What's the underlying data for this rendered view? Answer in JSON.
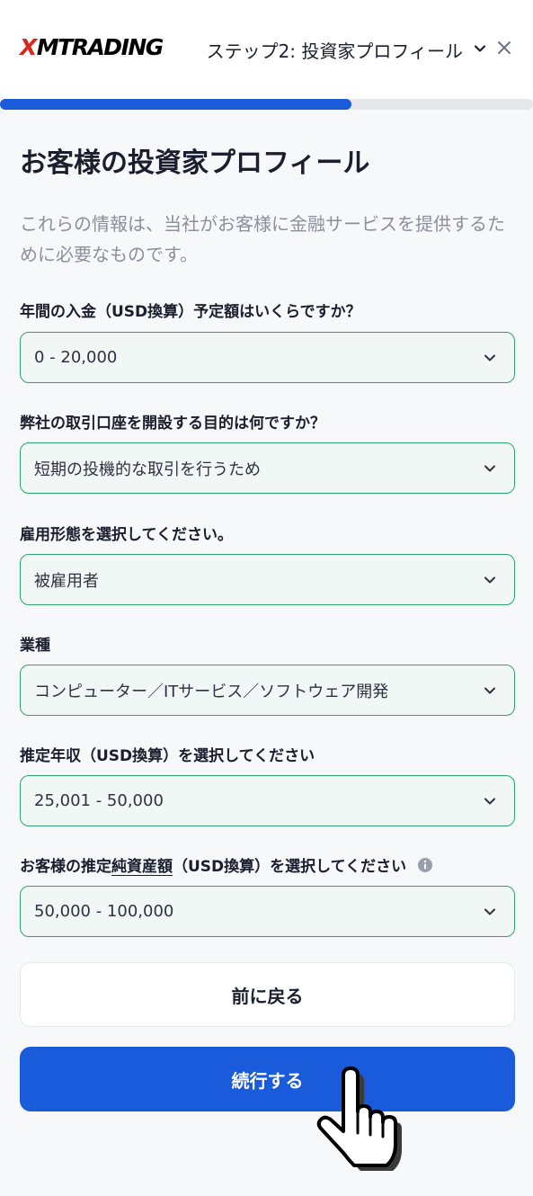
{
  "header": {
    "logo_x": "X",
    "logo_text": "MTRADING",
    "step_label": "ステップ2: 投資家プロフィール"
  },
  "progress": {
    "fraction": 0.66
  },
  "page": {
    "title": "お客様の投資家プロフィール",
    "intro": "これらの情報は、当社がお客様に金融サービスを提供するために必要なものです。"
  },
  "fields": [
    {
      "label": "年間の入金（USD換算）予定額はいくらですか？",
      "value": "0 - 20,000"
    },
    {
      "label": "弊社の取引口座を開設する目的は何ですか？",
      "value": "短期の投機的な取引を行うため"
    },
    {
      "label": "雇用形態を選択してください。",
      "value": "被雇用者"
    },
    {
      "label": "業種",
      "value": "コンピューター／ITサービス／ソフトウェア開発"
    },
    {
      "label": "推定年収（USD換算）を選択してください",
      "value": "25,001 - 50,000"
    },
    {
      "label_prefix": "お客様の推定",
      "label_underlined": "純資産額",
      "label_suffix": "（USD換算）を選択してください",
      "value": "50,000 - 100,000"
    }
  ],
  "buttons": {
    "back": "前に戻る",
    "continue": "続行する"
  },
  "colors": {
    "brand_red": "#d52b1e",
    "primary_blue": "#1a5bdb",
    "field_border_green": "#2fa36c",
    "field_bg": "#f1f7f4"
  },
  "icons": [
    "chevron-down-icon",
    "close-icon",
    "info-icon",
    "hand-pointer-icon"
  ]
}
